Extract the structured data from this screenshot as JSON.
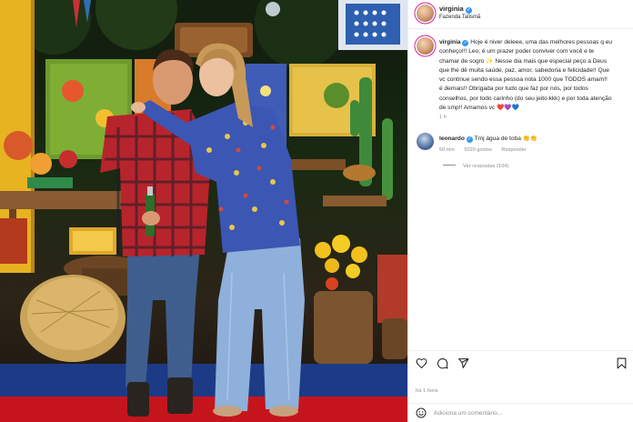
{
  "post": {
    "author": "virginia",
    "location": "Fazenda Talismã",
    "caption_author": "virginia",
    "caption_lines": [
      "Hoje é niver deleee, uma das melhores pessoas q eu",
      "conheço!!! Leo, é um prazer poder conviver com você e te",
      "chamar de sogro ✨ Nesse dia mais que especial peço a Deus",
      "que lhe dê muita saúde, paz, amor, sabedoria e felicidade!! Que",
      "vc continue sendo essa pessoa nota 1000 que TODOS amam!!",
      "é demais!! Obrigada por tudo que faz por nós, por todos",
      "conselhos, por todo carinho (do seu jeito kkk) e por toda atenção",
      "de smp!! Amamos vc ❤️💜💙"
    ],
    "caption_time": "1 h",
    "time_ago": "há 1 hora"
  },
  "comment": {
    "author": "leonardo",
    "text": "Tmj água de toba 👏👏",
    "time": "50 min",
    "likes": "5020 gostos",
    "reply_label": "Responder",
    "view_replies": "Ver respostas (164)"
  },
  "add_comment": {
    "placeholder": "Adiciona um comentário..."
  },
  "icons": {
    "like": "heart-icon",
    "comment": "comment-icon",
    "share": "share-icon",
    "save": "bookmark-icon",
    "emoji": "emoji-icon",
    "verified": "verified-badge-icon"
  },
  "colors": {
    "verified_blue": "#3897f0",
    "muted_text": "#8e8e8e",
    "text": "#262626",
    "carpet_red": "#c6141c"
  }
}
